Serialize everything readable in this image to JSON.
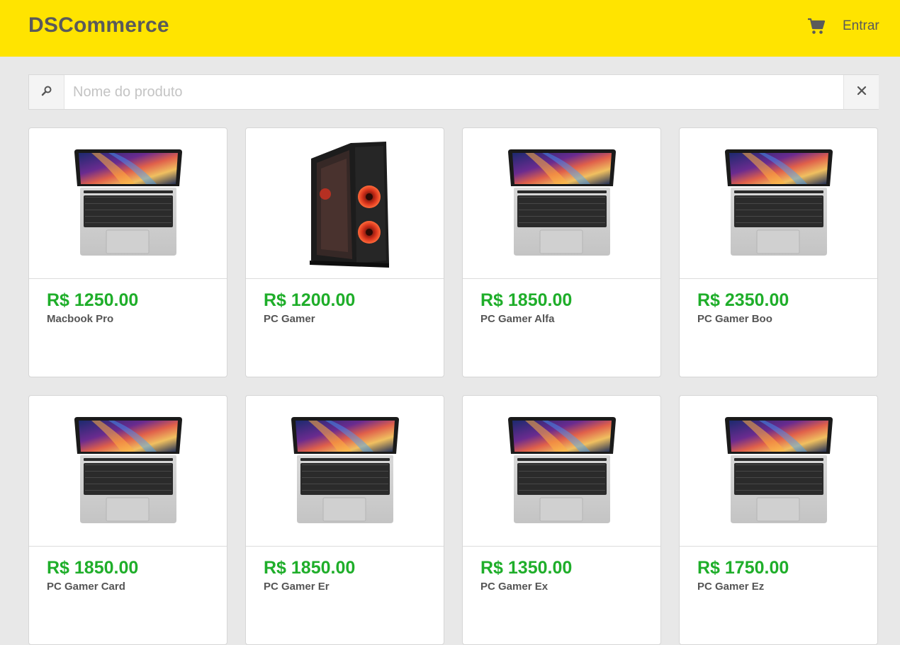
{
  "header": {
    "brand": "DSCommerce",
    "cart_icon": "shopping-cart-icon",
    "login_label": "Entrar",
    "background_color": "#ffe400"
  },
  "search": {
    "placeholder": "Nome do produto",
    "value": "",
    "search_icon": "search-icon",
    "clear_icon": "close-icon"
  },
  "products": [
    {
      "price": "R$ 1250.00",
      "name": "Macbook Pro",
      "image": "laptop"
    },
    {
      "price": "R$ 1200.00",
      "name": "PC Gamer",
      "image": "pc-tower"
    },
    {
      "price": "R$ 1850.00",
      "name": "PC Gamer Alfa",
      "image": "laptop"
    },
    {
      "price": "R$ 2350.00",
      "name": "PC Gamer Boo",
      "image": "laptop"
    },
    {
      "price": "R$ 1850.00",
      "name": "PC Gamer Card",
      "image": "laptop"
    },
    {
      "price": "R$ 1850.00",
      "name": "PC Gamer Er",
      "image": "laptop"
    },
    {
      "price": "R$ 1350.00",
      "name": "PC Gamer Ex",
      "image": "laptop"
    },
    {
      "price": "R$ 1750.00",
      "name": "PC Gamer Ez",
      "image": "laptop"
    }
  ],
  "colors": {
    "price": "#1fae2a",
    "page_background": "#e8e8e8",
    "text": "#5a5a5a"
  }
}
